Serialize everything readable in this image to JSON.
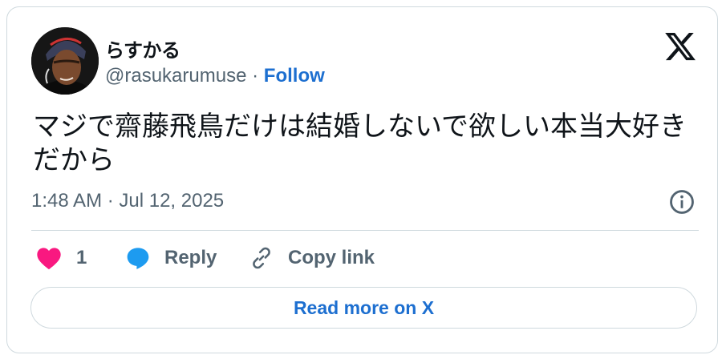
{
  "author": {
    "display_name": "らすかる",
    "handle": "@rasukarumuse",
    "separator": "·",
    "follow_label": "Follow"
  },
  "tweet": {
    "text": "マジで齋藤飛鳥だけは結婚しないで欲しい本当大好きだから",
    "timestamp": "1:48 AM · Jul 12, 2025"
  },
  "actions": {
    "like_count": "1",
    "reply_label": "Reply",
    "copy_link_label": "Copy link"
  },
  "read_more_label": "Read more on X",
  "icons": {
    "logo": "x-logo-icon",
    "info": "info-icon",
    "like": "heart-icon",
    "reply": "speech-bubble-icon",
    "copy": "link-icon"
  },
  "colors": {
    "text": "#0f1419",
    "secondary": "#536471",
    "link": "#1d6fd0",
    "like": "#f91880",
    "reply": "#1d9bf0",
    "border": "#cfd9de"
  }
}
